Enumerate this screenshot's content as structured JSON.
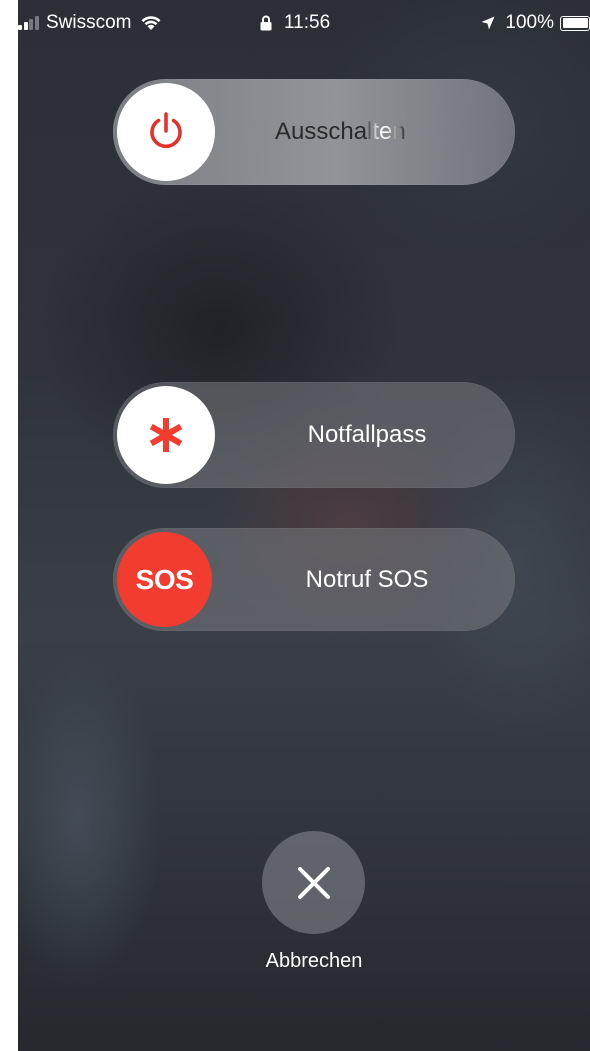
{
  "status_bar": {
    "carrier": "Swisscom",
    "time": "11:56",
    "battery": "100%",
    "signal_bars": 4,
    "signal_bars_active": 2,
    "battery_level": 1.0
  },
  "power_slider": {
    "label": "Ausschalten",
    "icon": "power-icon",
    "icon_color": "#e5312c"
  },
  "medical_slider": {
    "label": "Notfallpass",
    "icon": "asterisk-icon",
    "icon_color": "#f23c30"
  },
  "sos_slider": {
    "label": "Notruf SOS",
    "knob_text": "SOS",
    "knob_color": "#f23c30"
  },
  "cancel": {
    "label": "Abbrechen",
    "icon": "close-icon"
  }
}
